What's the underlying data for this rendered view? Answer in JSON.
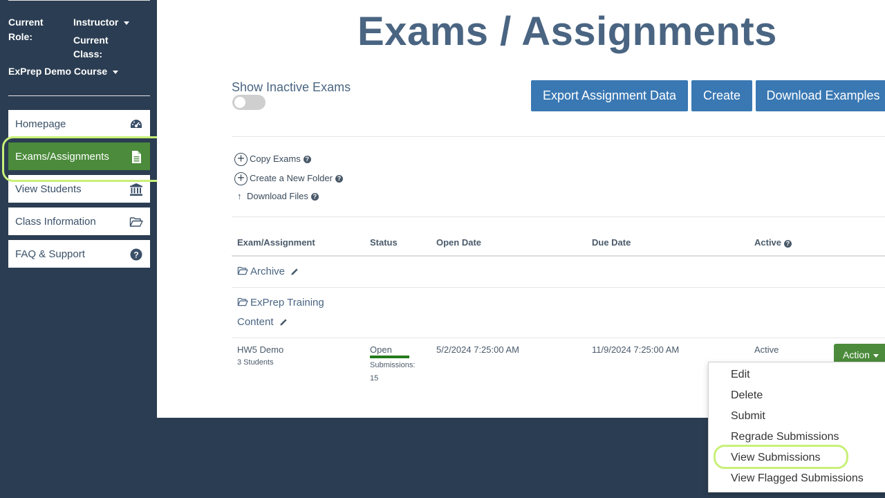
{
  "sidebar": {
    "role_label": "Current Role:",
    "role_value": "Instructor",
    "class_label": "Current Class:",
    "class_value": "ExPrep Demo Course",
    "nav": [
      {
        "label": "Homepage",
        "icon": "dashboard-icon"
      },
      {
        "label": "Exams/Assignments",
        "icon": "document-icon",
        "active": true
      },
      {
        "label": "View Students",
        "icon": "institution-icon"
      },
      {
        "label": "Class Information",
        "icon": "folder-open-icon"
      },
      {
        "label": "FAQ & Support",
        "icon": "question-circle-icon"
      }
    ]
  },
  "main": {
    "title": "Exams / Assignments",
    "toggle_label": "Show Inactive Exams",
    "buttons": {
      "export": "Export Assignment Data",
      "create": "Create",
      "download": "Download Examples"
    },
    "tools": {
      "copy": "Copy Exams",
      "folder": "Create a New Folder",
      "download_files": "Download Files"
    },
    "table": {
      "headers": {
        "exam": "Exam/Assignment",
        "status": "Status",
        "open": "Open Date",
        "due": "Due Date",
        "active": "Active"
      },
      "folders": [
        {
          "name": "Archive"
        },
        {
          "name_line1": "ExPrep Training",
          "name_line2": "Content"
        }
      ],
      "row": {
        "name": "HW5 Demo",
        "students": "3 Students",
        "status": "Open",
        "submissions_label": "Submissions:",
        "submissions": "15",
        "open_date": "5/2/2024 7:25:00 AM",
        "due_date": "11/9/2024 7:25:00 AM",
        "active": "Active",
        "action": "Action"
      }
    }
  },
  "dropdown": {
    "items": [
      "Edit",
      "Delete",
      "Submit",
      "Regrade Submissions",
      "View Submissions",
      "View Flagged Submissions"
    ]
  },
  "colors": {
    "sidebar_bg": "#2b3d52",
    "active_green": "#4b8b3b",
    "button_blue": "#3978b3",
    "highlight": "#c8f078"
  }
}
